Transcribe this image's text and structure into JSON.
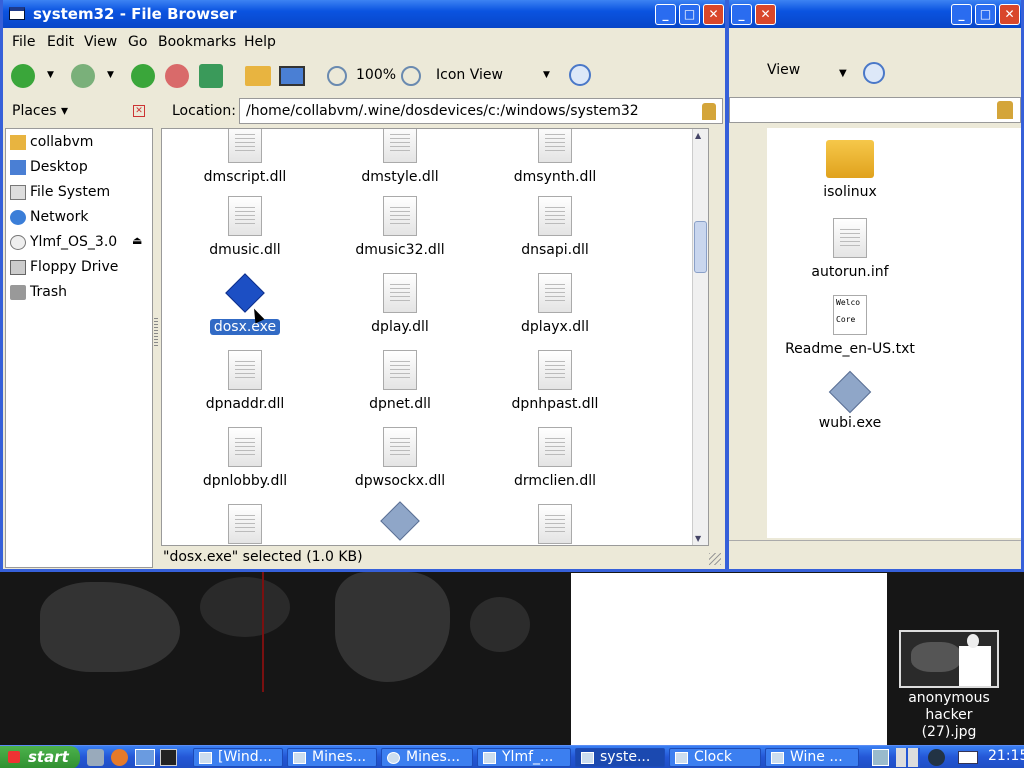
{
  "back_window": {
    "title_hidden": "",
    "view_mode": "View",
    "files": [
      "isolinux",
      "autorun.inf",
      "Readme_en-US.txt",
      "wubi.exe"
    ],
    "readme_preview": [
      "Welco",
      "Core"
    ]
  },
  "window": {
    "title": "system32 - File Browser",
    "menu": [
      "File",
      "Edit",
      "View",
      "Go",
      "Bookmarks",
      "Help"
    ],
    "zoom": "100%",
    "view_mode": "Icon View",
    "places_label": "Places ▾",
    "location_label": "Location:",
    "location": "/home/collabvm/.wine/dosdevices/c:/windows/system32",
    "places": [
      "collabvm",
      "Desktop",
      "File System",
      "Network",
      "Ylmf_OS_3.0",
      "Floppy Drive",
      "Trash"
    ],
    "files": [
      "dmscript.dll",
      "dmstyle.dll",
      "dmsynth.dll",
      "dmusic.dll",
      "dmusic32.dll",
      "dnsapi.dll",
      "dosx.exe",
      "dplay.dll",
      "dplayx.dll",
      "dpnaddr.dll",
      "dpnet.dll",
      "dpnhpast.dll",
      "dpnlobby.dll",
      "dpwsockx.dll",
      "drmclien.dll",
      "",
      "",
      ""
    ],
    "selected": "dosx.exe",
    "status": "\"dosx.exe\" selected (1.0 KB)"
  },
  "desktop": {
    "icon_label_1": "anonymous hacker",
    "icon_label_2": "(27).jpg"
  },
  "taskbar": {
    "start": "start",
    "buttons": [
      "[Wind...",
      "Mines...",
      "Mines...",
      "Ylmf_...",
      "syste...",
      "Clock",
      "Wine ..."
    ],
    "clock": "21:15"
  },
  "colors": {
    "title_blue": "#0a53e0",
    "selection": "#316ac5",
    "start_green": "#2f8f2f"
  }
}
